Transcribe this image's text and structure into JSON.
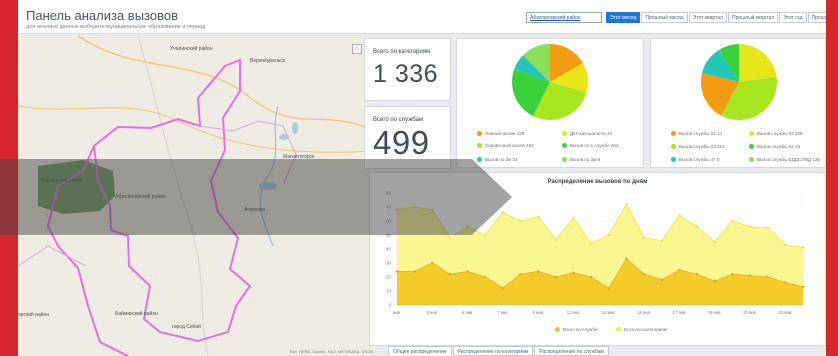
{
  "header": {
    "title": "Панель анализа вызовов",
    "subtitle": "для анализа данных выберите муниципальное образование и период",
    "region_selector": "Абзелиловский район",
    "period_tabs": [
      {
        "label": "Этот месяц",
        "active": true
      },
      {
        "label": "Прошлый месяц",
        "active": false
      },
      {
        "label": "Этот квартал",
        "active": false
      },
      {
        "label": "Прошлый квартал",
        "active": false
      },
      {
        "label": "Этот год",
        "active": false
      },
      {
        "label": "Прошлый год",
        "active": false
      }
    ]
  },
  "map": {
    "labels": {
      "uchalinsky": "Учалинский район",
      "verkhneuralsk": "Верхнеуральск",
      "burzyansky": "Бурзянский район",
      "abzelilovsky": "Абзелиловский район",
      "magnitogorsk": "Магнитогорск",
      "agapovka": "Агаповка",
      "bayimaksky": "Баймакский район",
      "sibay": "город Сибай",
      "khaibullinsky": "орский район"
    },
    "attribution": "Esri, HERE, Garmin, FAO, METI/NASA, USGS"
  },
  "kpi": {
    "categories_label": "Всего по категориям",
    "categories_value": "1 336",
    "services_label": "Всего по службам",
    "services_value": "499"
  },
  "pie_categories": {
    "legend": [
      {
        "label": "Ложный вызов",
        "value": "129",
        "color": "#f39c12"
      },
      {
        "label": "Детская шалость",
        "value": "42",
        "color": "#e6e619"
      },
      {
        "label": "Справочный вызов",
        "value": "452",
        "color": "#a8e61f"
      },
      {
        "label": "Вызов по 1 службе",
        "value": "462",
        "color": "#3ad13a"
      },
      {
        "label": "Вызов по 2м",
        "value": "32",
        "color": "#22c7b8"
      },
      {
        "label": "Вызов по 3м",
        "value": "9",
        "color": "#8adf5a"
      }
    ]
  },
  "pie_services": {
    "legend": [
      {
        "label": "Вызов службы 01",
        "value": "14",
        "color": "#f39c12"
      },
      {
        "label": "Вызов службы 02",
        "value": "108",
        "color": "#e6e619"
      },
      {
        "label": "Вызов службы 03",
        "value": "213",
        "color": "#a8e61f"
      },
      {
        "label": "Вызов службы 04",
        "value": "34",
        "color": "#3ad13a"
      },
      {
        "label": "Вызов службы 47",
        "value": "0",
        "color": "#22c7b8"
      },
      {
        "label": "Вызов службы ЕДДС/УВД",
        "value": "135",
        "color": "#8adf5a"
      }
    ]
  },
  "line_chart": {
    "tabs": [
      "Общее распределение",
      "Распределение по категориям",
      "Распределение по службам"
    ],
    "legend": [
      {
        "label": "Всего по службе",
        "color": "#f2c61f"
      },
      {
        "label": "Всего по категориям",
        "color": "#f7ec3a"
      }
    ]
  },
  "chart_data": {
    "type": "area",
    "title": "Распределение вызовов по дням",
    "xlabel": "",
    "ylabel": "",
    "ylim": [
      0,
      80
    ],
    "yticks": [
      0,
      10,
      20,
      30,
      40,
      50,
      60,
      70,
      80
    ],
    "tick_labels": [
      "янв.",
      "3 янв.",
      "5 янв.",
      "7 янв.",
      "9 янв.",
      "11 янв.",
      "13 янв.",
      "15 янв.",
      "17 янв.",
      "19 янв.",
      "21 янв.",
      "23 янв."
    ],
    "x": [
      "1 янв.",
      "2 янв.",
      "3 янв.",
      "4 янв.",
      "5 янв.",
      "6 янв.",
      "7 янв.",
      "8 янв.",
      "9 янв.",
      "10 янв.",
      "11 янв.",
      "12 янв.",
      "13 янв.",
      "14 янв.",
      "15 янв.",
      "16 янв.",
      "17 янв.",
      "18 янв.",
      "19 янв.",
      "20 янв.",
      "21 янв.",
      "22 янв.",
      "23 янв.",
      "24 янв."
    ],
    "series": [
      {
        "name": "Всего по категориям",
        "values": [
          68,
          70,
          68,
          48,
          56,
          50,
          66,
          60,
          63,
          47,
          62,
          44,
          50,
          72,
          48,
          46,
          64,
          56,
          45,
          60,
          56,
          55,
          43,
          41
        ]
      },
      {
        "name": "Всего по службе",
        "values": [
          24,
          24,
          30,
          22,
          24,
          20,
          12,
          22,
          24,
          20,
          23,
          20,
          12,
          33,
          22,
          18,
          25,
          22,
          17,
          22,
          21,
          20,
          16,
          13
        ]
      }
    ]
  }
}
